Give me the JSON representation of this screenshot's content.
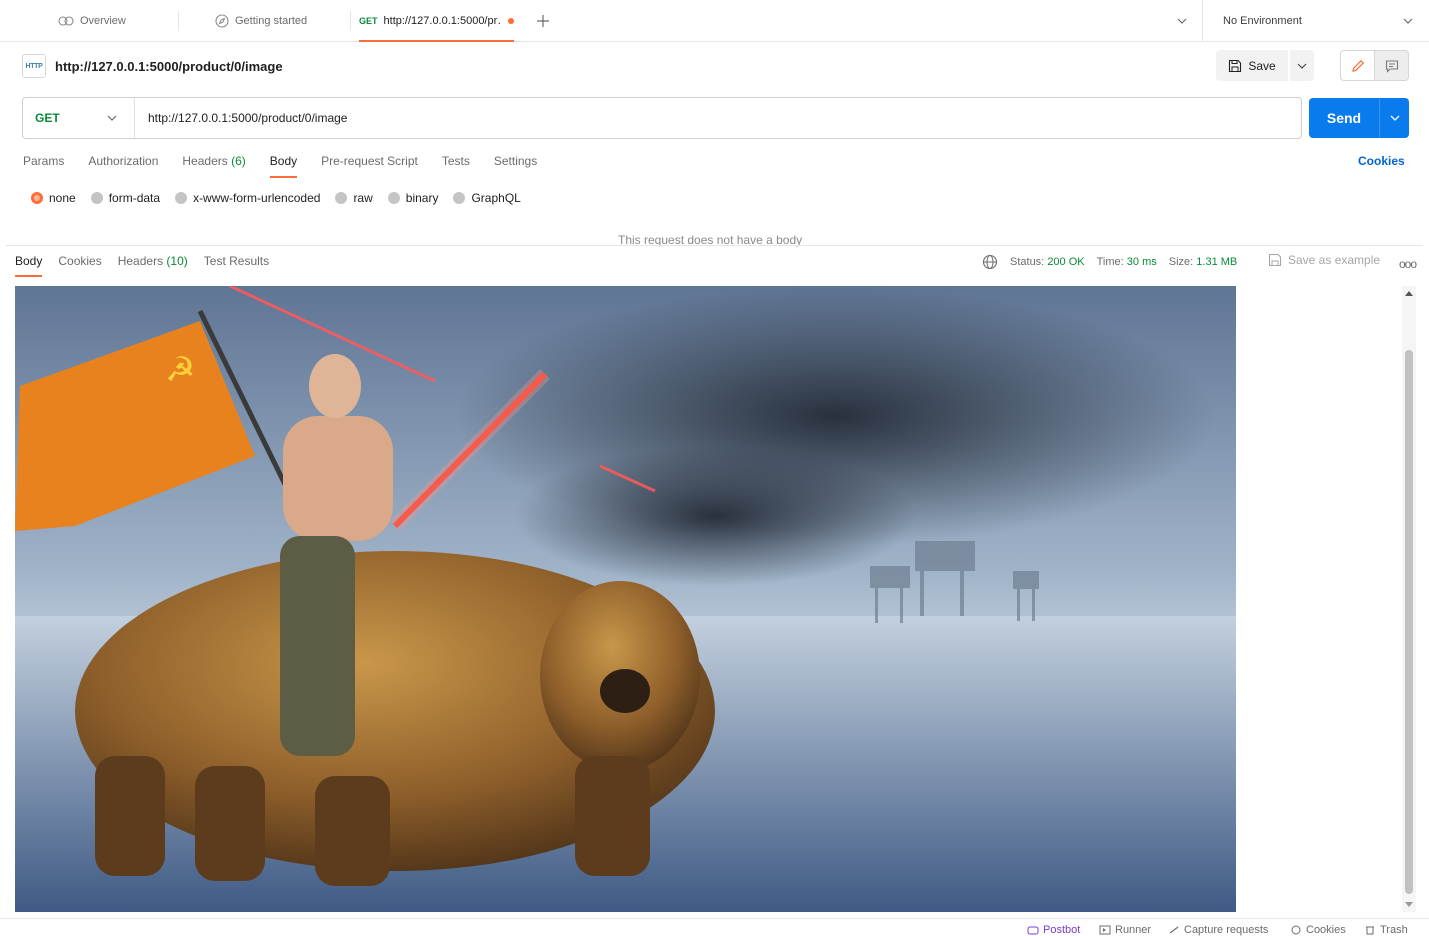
{
  "tabs": [
    {
      "label": "Overview",
      "icon": "people-icon"
    },
    {
      "label": "Getting started",
      "icon": "compass-icon"
    },
    {
      "method": "GET",
      "label": "http://127.0.0.1:5000/pr…",
      "unsaved": true,
      "active": true
    }
  ],
  "environment": {
    "label": "No Environment"
  },
  "request": {
    "title": "http://127.0.0.1:5000/product/0/image",
    "icon_text": "HTTP",
    "save_label": "Save",
    "method": "GET",
    "url": "http://127.0.0.1:5000/product/0/image",
    "send_label": "Send"
  },
  "request_tabs": {
    "params": "Params",
    "authorization": "Authorization",
    "headers": "Headers",
    "headers_count": "(6)",
    "body": "Body",
    "prerequest": "Pre-request Script",
    "tests": "Tests",
    "settings": "Settings",
    "cookies": "Cookies"
  },
  "body_options": {
    "selected": "none",
    "none": "none",
    "form_data": "form-data",
    "urlencoded": "x-www-form-urlencoded",
    "raw": "raw",
    "binary": "binary",
    "graphql": "GraphQL",
    "empty_message": "This request does not have a body"
  },
  "response": {
    "tabs": {
      "body": "Body",
      "cookies": "Cookies",
      "headers": "Headers",
      "headers_count": "(10)",
      "test_results": "Test Results"
    },
    "status_label": "Status:",
    "status": "200 OK",
    "time_label": "Time:",
    "time": "30 ms",
    "size_label": "Size:",
    "size": "1.31 MB",
    "save_example": "Save as example",
    "more": "ooo"
  },
  "statusbar": {
    "postbot": "Postbot",
    "runner": "Runner",
    "capture": "Capture requests",
    "cookies": "Cookies",
    "trash": "Trash"
  },
  "colors": {
    "accent": "#ff6c37",
    "send": "#097bed",
    "method_get": "#0b8a38",
    "link": "#0265d2"
  }
}
